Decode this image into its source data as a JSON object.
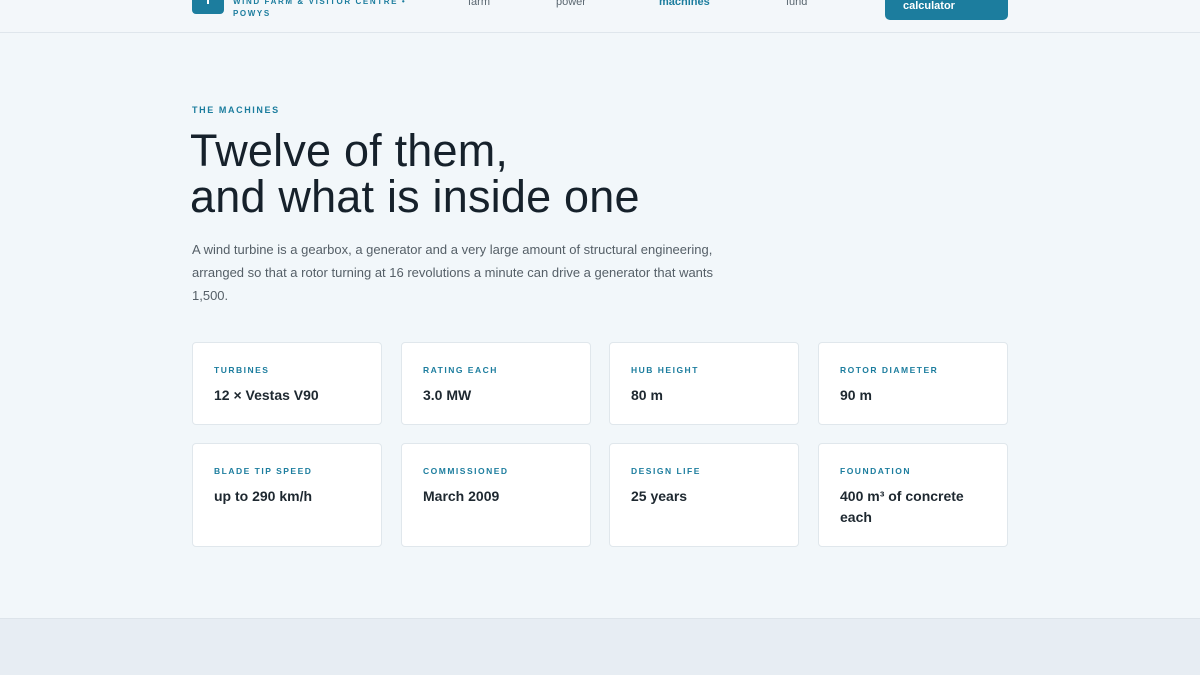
{
  "brand": {
    "tagline": "WIND FARM & VISITOR CENTRE • POWYS"
  },
  "nav": {
    "items": [
      {
        "label": "farm",
        "active": false
      },
      {
        "label": "power",
        "active": false
      },
      {
        "label": "machines",
        "active": true
      },
      {
        "label": "visit",
        "active": false
      },
      {
        "label": "fund",
        "active": false
      }
    ],
    "cta_label": "calculator"
  },
  "section": {
    "eyebrow": "THE MACHINES",
    "title_line1": "Twelve of them,",
    "title_line2": "and what is inside one",
    "lead": "A wind turbine is a gearbox, a generator and a very large amount of structural engineering, arranged so that a rotor turning at 16 revolutions a minute can drive a generator that wants 1,500."
  },
  "specs": [
    {
      "label": "TURBINES",
      "value": "12 × Vestas V90"
    },
    {
      "label": "RATING EACH",
      "value": "3.0 MW"
    },
    {
      "label": "HUB HEIGHT",
      "value": "80 m"
    },
    {
      "label": "ROTOR DIAMETER",
      "value": "90 m"
    },
    {
      "label": "BLADE TIP SPEED",
      "value": "up to 290 km/h"
    },
    {
      "label": "COMMISSIONED",
      "value": "March 2009"
    },
    {
      "label": "DESIGN LIFE",
      "value": "25 years"
    },
    {
      "label": "FOUNDATION",
      "value": "400 m³ of concrete each"
    }
  ],
  "colors": {
    "accent": "#1c7d9e",
    "background": "#f2f7fa",
    "heading": "#16212b"
  }
}
